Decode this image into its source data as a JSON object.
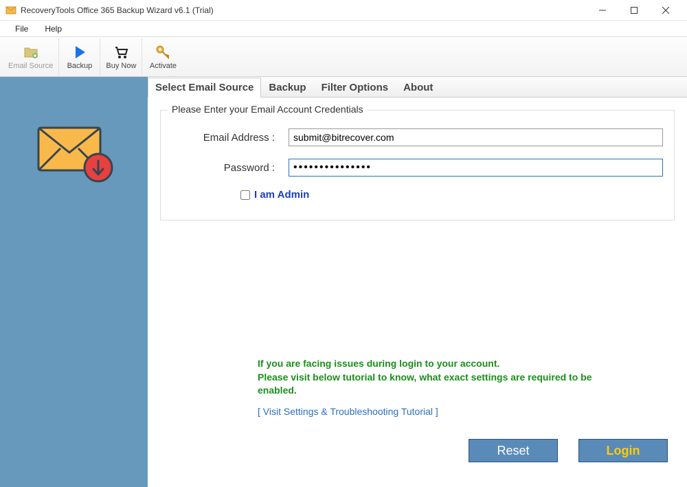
{
  "window": {
    "title": "RecoveryTools Office 365 Backup Wizard v6.1 (Trial)"
  },
  "menu": {
    "file": "File",
    "help": "Help"
  },
  "toolbar": {
    "email_source": "Email Source",
    "backup": "Backup",
    "buy_now": "Buy Now",
    "activate": "Activate"
  },
  "tabs": {
    "select_source": "Select Email Source",
    "backup": "Backup",
    "filter": "Filter Options",
    "about": "About"
  },
  "form": {
    "group_title": "Please Enter your Email Account Credentials",
    "email_label": "Email Address  :",
    "email_value": "submit@bitrecover.com",
    "password_label": "Password  :",
    "password_value": "•••••••••••••••",
    "admin_label": "I am Admin"
  },
  "help": {
    "line1": "If you are facing issues during login to your account.",
    "line2": "Please visit below tutorial to know, what exact settings are required to be enabled.",
    "tutorial": "[ Visit Settings & Troubleshooting Tutorial ]"
  },
  "buttons": {
    "reset": "Reset",
    "login": "Login"
  }
}
